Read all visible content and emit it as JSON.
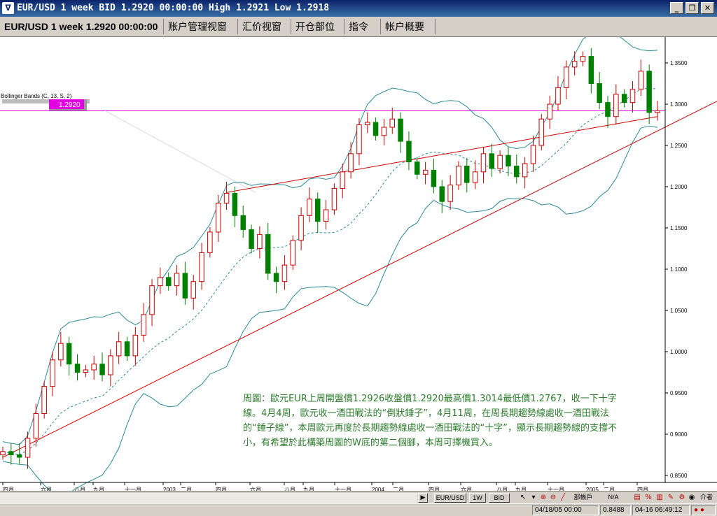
{
  "window": {
    "title": "EUR/USD 1 week BID 1.2920 00:00:00 High 1.2921 Low 1.2918",
    "minimize": "_",
    "restore": "❐",
    "close": "✕"
  },
  "tabs": [
    {
      "label": "EUR/USD 1 week 1.2920 00:00:00"
    },
    {
      "label": "账户管理视窗"
    },
    {
      "label": "汇价视窗"
    },
    {
      "label": "开仓部位"
    },
    {
      "label": "指令"
    },
    {
      "label": "帐户概要"
    }
  ],
  "indicator": {
    "label": "Bollinger Bands (C, 13, S, 2)"
  },
  "price_tag": "1.2920",
  "y_axis": {
    "ticks": [
      "1.3500",
      "1.3000",
      "1.2500",
      "1.2000",
      "1.1500",
      "1.1000",
      "1.0500",
      "1.0000",
      "0.9500",
      "0.9000",
      "0.8500"
    ]
  },
  "x_axis": {
    "ticks": [
      "四月",
      "六月",
      "八月",
      "九月",
      "十一月",
      "2003",
      "二月",
      "四月",
      "六月",
      "八月",
      "九月",
      "十一月",
      "2004",
      "二月",
      "四月",
      "六月",
      "八月",
      "九月",
      "十一月",
      "2005",
      "二月",
      "四月"
    ]
  },
  "annotation": "周圖：歐元EUR上周開盤價1.2926收盤價1.2920最高價1.3014最低價1.2767，收一下十字線。4月4周，歐元收一酒田戰法的“倒狀錘子”，4月11周，在周長期趨勢線處收一酒田戰法的“錘子線”，本周歐元再度於長期趨勢線處收一酒田戰法的“十字”，顯示長期趨勢線的支撐不小，有希望於此構築周圖的W底的第二個腳，本周可擇機買入。",
  "bottom_toolbar": {
    "symbol": "EUR/USD",
    "period": "1W",
    "side": "BID",
    "misc1": "部帳戶",
    "misc2": "N/A",
    "misc3": "介者"
  },
  "status": {
    "datetime": "04/18/05 00:00",
    "value": "0.8488",
    "clock": "04-16 06:49:12"
  },
  "colors": {
    "up": "#ffffff",
    "down": "#008000",
    "candle_outline": "#cc0000",
    "band": "#2a8a9a",
    "trendline": "#d00000",
    "price_line": "#e000e0"
  },
  "chart_data": {
    "type": "candlestick",
    "symbol": "EUR/USD",
    "ylim": [
      0.85,
      1.37
    ],
    "series": [
      {
        "name": "close",
        "values": [
          0.879,
          0.875,
          0.872,
          0.895,
          0.925,
          0.958,
          0.99,
          1.01,
          0.985,
          0.975,
          0.978,
          0.985,
          0.972,
          0.995,
          1.012,
          0.995,
          1.02,
          1.045,
          1.08,
          1.09,
          1.08,
          1.095,
          1.065,
          1.085,
          1.12,
          1.145,
          1.18,
          1.192,
          1.165,
          1.148,
          1.125,
          1.142,
          1.095,
          1.085,
          1.105,
          1.135,
          1.165,
          1.185,
          1.158,
          1.172,
          1.198,
          1.218,
          1.24,
          1.275,
          1.278,
          1.262,
          1.272,
          1.282,
          1.255,
          1.23,
          1.215,
          1.22,
          1.2,
          1.182,
          1.202,
          1.225,
          1.205,
          1.218,
          1.24,
          1.222,
          1.238,
          1.225,
          1.212,
          1.228,
          1.25,
          1.282,
          1.3,
          1.32,
          1.345,
          1.352,
          1.358,
          1.325,
          1.302,
          1.285,
          1.312,
          1.302,
          1.318,
          1.34,
          1.29,
          1.292
        ]
      }
    ],
    "bollinger_bands": {
      "period": 13,
      "stdev": 2
    }
  }
}
